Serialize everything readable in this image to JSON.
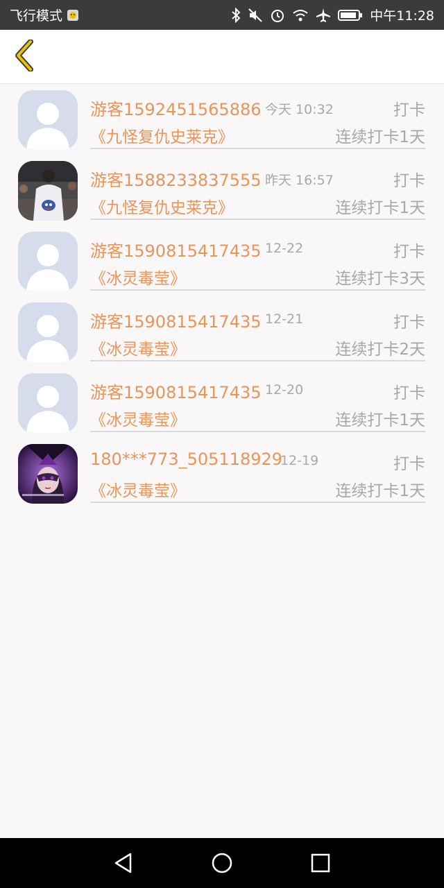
{
  "status_bar": {
    "left_text": "飞行模式",
    "time": "中午11:28",
    "icons": [
      "bluetooth-icon",
      "mute-icon",
      "alarm-icon",
      "wifi-icon",
      "airplane-icon",
      "battery-icon"
    ]
  },
  "header": {
    "back_icon": "chevron-left-icon",
    "accent": "#e8c300"
  },
  "colors": {
    "accent_text": "#e8955a",
    "muted_text": "#a8a8a8",
    "background": "#f9f7f8"
  },
  "checkins": [
    {
      "user": "游客1592451565886",
      "time": "今天 10:32",
      "action": "打卡",
      "title": "《九怪复仇史莱克》",
      "streak": "连续打卡1天",
      "avatar": "default-avatar"
    },
    {
      "user": "游客1588233837555",
      "time": "昨天 16:57",
      "action": "打卡",
      "title": "《九怪复仇史莱克》",
      "streak": "连续打卡1天",
      "avatar": "photo-avatar-person"
    },
    {
      "user": "游客1590815417435",
      "time": "12-22",
      "action": "打卡",
      "title": "《冰灵毒莹》",
      "streak": "连续打卡3天",
      "avatar": "default-avatar"
    },
    {
      "user": "游客1590815417435",
      "time": "12-21",
      "action": "打卡",
      "title": "《冰灵毒莹》",
      "streak": "连续打卡2天",
      "avatar": "default-avatar"
    },
    {
      "user": "游客1590815417435",
      "time": "12-20",
      "action": "打卡",
      "title": "《冰灵毒莹》",
      "streak": "连续打卡1天",
      "avatar": "default-avatar"
    },
    {
      "user": "180***773_505118929",
      "time": "12-19",
      "action": "打卡",
      "title": "《冰灵毒莹》",
      "streak": "连续打卡1天",
      "avatar": "photo-avatar-anime"
    }
  ],
  "nav_bar": {
    "icons": [
      "back-triangle-icon",
      "home-circle-icon",
      "recents-square-icon"
    ]
  }
}
